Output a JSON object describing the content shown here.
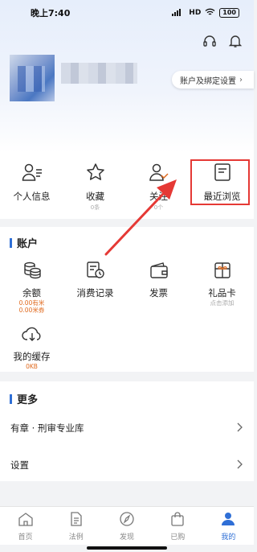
{
  "status_bar": {
    "time": "晚上7:40",
    "signal": "HD",
    "battery": "100"
  },
  "header": {
    "account_settings_label": "账户及绑定设置"
  },
  "quick": {
    "personal_info": "个人信息",
    "favorites": "收藏",
    "favorites_count": "0条",
    "follow": "关注",
    "follow_count": "0个",
    "recent": "最近浏览"
  },
  "account": {
    "title": "账户",
    "balance": "余额",
    "balance_line1": "0.00有米",
    "balance_line2": "0.00米券",
    "consumption": "消费记录",
    "invoice": "发票",
    "gift_card": "礼品卡",
    "gift_card_sub": "点击添加",
    "cache": "我的缓存",
    "cache_size": "0KB"
  },
  "more": {
    "title": "更多",
    "items": [
      "有章 · 刑审专业库",
      "设置"
    ]
  },
  "tabs": [
    "首页",
    "法例",
    "发现",
    "已购",
    "我的"
  ],
  "colors": {
    "accent": "#2f6fd6",
    "highlight": "#e53935",
    "orange": "#e06a1e"
  }
}
